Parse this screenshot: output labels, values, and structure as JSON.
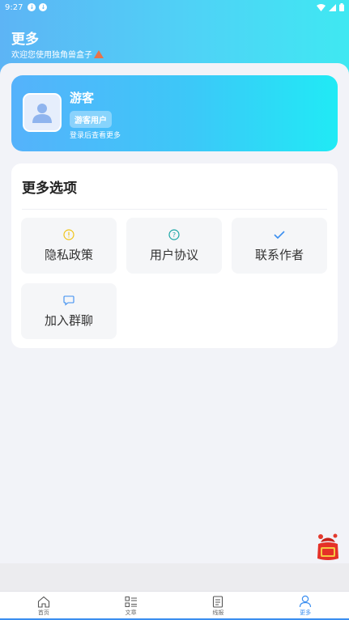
{
  "status_bar": {
    "time": "9:27",
    "notification_icons": [
      "app-icon",
      "app-icon"
    ],
    "right_icons": [
      "wifi-icon",
      "signal-icon",
      "battery-icon"
    ]
  },
  "header": {
    "title": "更多",
    "subtitle": "欢迎您使用独角兽盒子"
  },
  "profile": {
    "name": "游客",
    "badge": "游客用户",
    "hint": "登录后查看更多"
  },
  "options": {
    "title": "更多选项",
    "items": [
      {
        "label": "隐私政策",
        "icon": "info-circle-icon",
        "color": "#f0c419"
      },
      {
        "label": "用户协议",
        "icon": "question-circle-icon",
        "color": "#1aa6a6"
      },
      {
        "label": "联系作者",
        "icon": "check-icon",
        "color": "#3a8ef0"
      },
      {
        "label": "加入群聊",
        "icon": "chat-bubble-icon",
        "color": "#3a8ef0"
      }
    ]
  },
  "floating": {
    "redpacket_icon": "redpacket-icon"
  },
  "tabbar": {
    "tabs": [
      {
        "label": "首页",
        "icon": "home-icon"
      },
      {
        "label": "文章",
        "icon": "list-icon"
      },
      {
        "label": "线报",
        "icon": "document-icon"
      },
      {
        "label": "更多",
        "icon": "user-icon",
        "active": true
      }
    ]
  },
  "colors": {
    "accent": "#3a8ef0",
    "header_gradient_start": "#5db4f5",
    "header_gradient_end": "#3fe8f2"
  }
}
